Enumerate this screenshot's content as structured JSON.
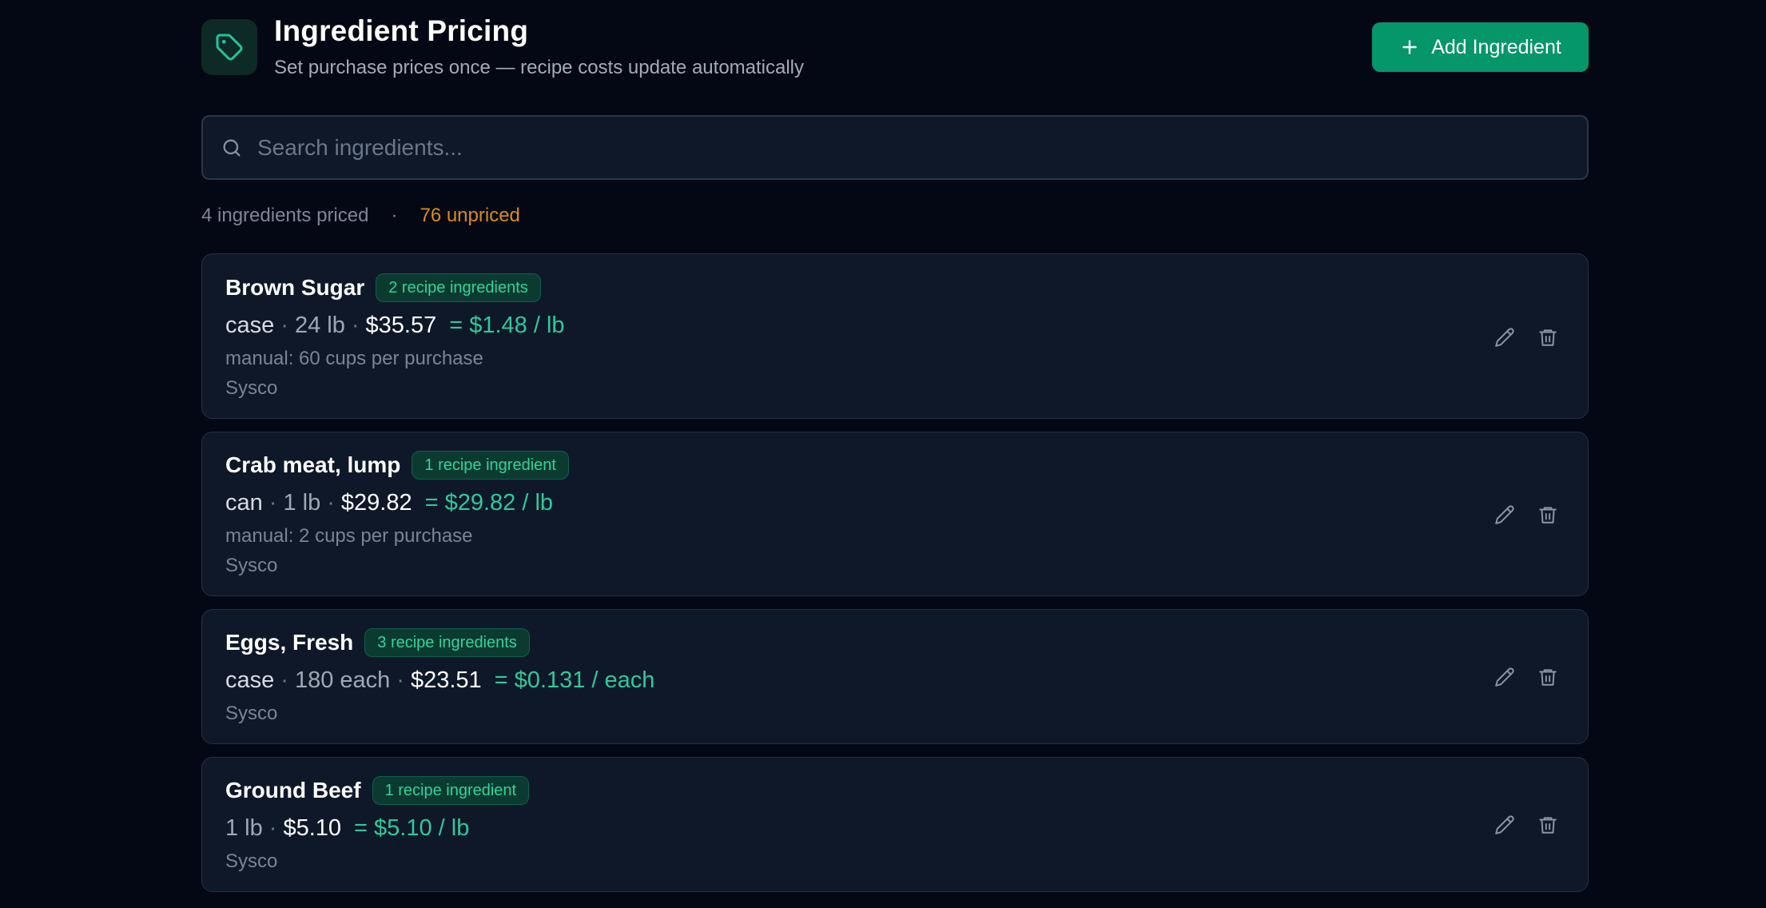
{
  "header": {
    "icon": "tag-icon",
    "title": "Ingredient Pricing",
    "subtitle": "Set purchase prices once — recipe costs update automatically",
    "add_button": "Add Ingredient",
    "add_icon": "plus-icon"
  },
  "search": {
    "icon": "search-icon",
    "placeholder": "Search ingredients...",
    "value": ""
  },
  "stats": {
    "priced": "4 ingredients priced",
    "separator": "·",
    "unpriced": "76 unpriced"
  },
  "colors": {
    "accent": "#059669",
    "rate": "#2fc99a",
    "warning": "#d98c1c",
    "background": "#040814",
    "card": "#0f1829"
  },
  "ingredients": [
    {
      "name": "Brown Sugar",
      "badge": "2 recipe ingredients",
      "unit": "case",
      "quantity": "24 lb",
      "price": "$35.57",
      "rate": "= $1.48 / lb",
      "manual": "manual: 60 cups per purchase",
      "vendor": "Sysco"
    },
    {
      "name": "Crab meat, lump",
      "badge": "1 recipe ingredient",
      "unit": "can",
      "quantity": "1 lb",
      "price": "$29.82",
      "rate": "= $29.82 / lb",
      "manual": "manual: 2 cups per purchase",
      "vendor": "Sysco"
    },
    {
      "name": "Eggs, Fresh",
      "badge": "3 recipe ingredients",
      "unit": "case",
      "quantity": "180 each",
      "price": "$23.51",
      "rate": "= $0.131 / each",
      "vendor": "Sysco"
    },
    {
      "name": "Ground Beef",
      "badge": "1 recipe ingredient",
      "quantity": "1 lb",
      "price": "$5.10",
      "rate": "= $5.10 / lb",
      "vendor": "Sysco"
    }
  ],
  "actions": {
    "edit_icon": "pencil-icon",
    "delete_icon": "trash-icon"
  }
}
